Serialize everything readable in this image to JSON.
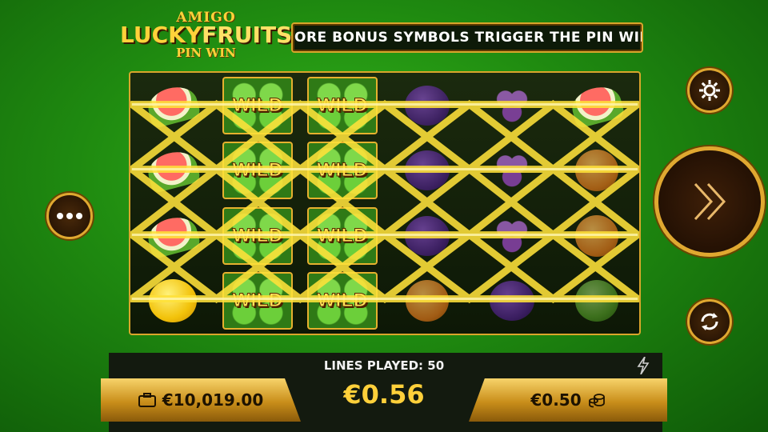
{
  "logo": {
    "line1": "AMIGO",
    "lucky": "LUCKY",
    "fruits": "FRUITS",
    "line3": "PIN WIN"
  },
  "ticker": {
    "text": "ORE BONUS SYMBOLS TRIGGER THE PIN WIN BONU"
  },
  "reels": {
    "columns": 6,
    "rows": 4,
    "cells": [
      [
        "watermelon",
        "wild",
        "wild",
        "plum",
        "grapes",
        "watermelon"
      ],
      [
        "watermelon",
        "wild",
        "wild",
        "plum",
        "grapes",
        "orange"
      ],
      [
        "watermelon",
        "wild",
        "wild",
        "plum",
        "grapes",
        "orange"
      ],
      [
        "lemon",
        "wild",
        "wild",
        "orange",
        "plum",
        "lime"
      ]
    ],
    "wild_label": "WILD"
  },
  "buttons": {
    "menu": "ellipsis-icon",
    "settings": "gear-icon",
    "spin": "double-chevron-right-icon",
    "autoplay": "refresh-icon"
  },
  "bottom": {
    "lines_played": "LINES PLAYED: 50",
    "total_bet": "€0.56",
    "balance": "€10,019.00",
    "stake": "€0.50"
  },
  "colors": {
    "gold": "#d9a52b",
    "green_bg": "#1f8a10",
    "win_line": "#ffe23a"
  }
}
